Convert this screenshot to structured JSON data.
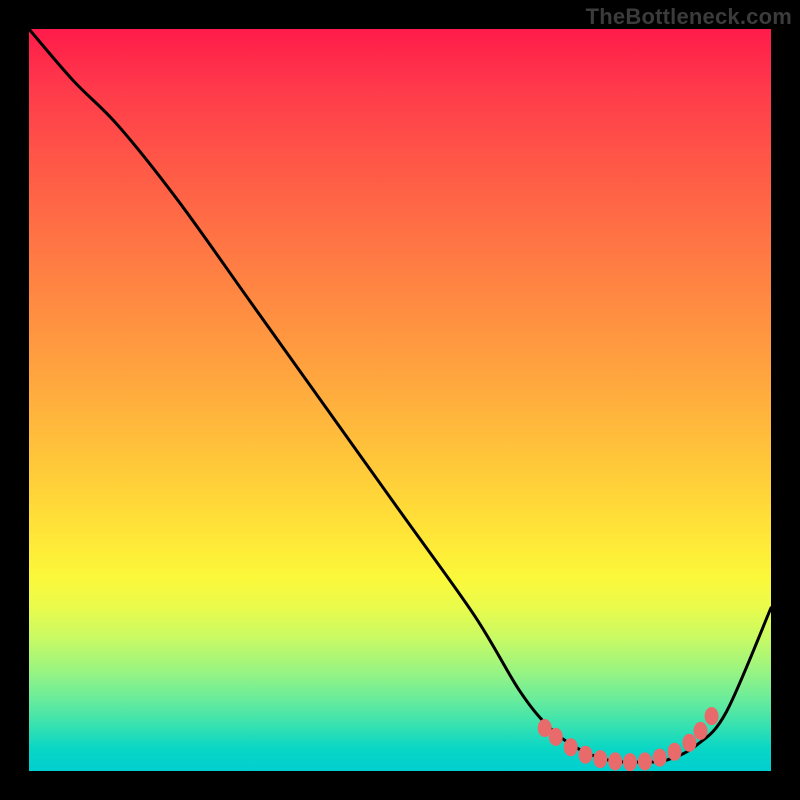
{
  "watermark": "TheBottleneck.com",
  "chart_data": {
    "type": "line",
    "title": "",
    "xlabel": "",
    "ylabel": "",
    "xlim": [
      0,
      100
    ],
    "ylim": [
      0,
      100
    ],
    "series": [
      {
        "name": "bottleneck-curve",
        "x": [
          0,
          6,
          12,
          20,
          30,
          40,
          50,
          60,
          66,
          70,
          74,
          78,
          82,
          86,
          90,
          94,
          100
        ],
        "y": [
          100,
          93,
          87,
          77,
          63,
          49,
          35,
          21,
          11,
          6,
          3,
          1.5,
          1.2,
          1.5,
          3.5,
          8,
          22
        ]
      }
    ],
    "markers": {
      "name": "optimal-zone-dots",
      "color": "#e96a6a",
      "points": [
        {
          "x": 69.5,
          "y": 5.8
        },
        {
          "x": 71.0,
          "y": 4.6
        },
        {
          "x": 73.0,
          "y": 3.2
        },
        {
          "x": 75.0,
          "y": 2.2
        },
        {
          "x": 77.0,
          "y": 1.6
        },
        {
          "x": 79.0,
          "y": 1.3
        },
        {
          "x": 81.0,
          "y": 1.2
        },
        {
          "x": 83.0,
          "y": 1.3
        },
        {
          "x": 85.0,
          "y": 1.8
        },
        {
          "x": 87.0,
          "y": 2.6
        },
        {
          "x": 89.0,
          "y": 3.8
        },
        {
          "x": 90.5,
          "y": 5.4
        },
        {
          "x": 92.0,
          "y": 7.4
        }
      ]
    },
    "gradient_stops": [
      {
        "pct": 0,
        "color": "#ff1b4a"
      },
      {
        "pct": 8,
        "color": "#ff3a4b"
      },
      {
        "pct": 18,
        "color": "#ff5747"
      },
      {
        "pct": 30,
        "color": "#ff7844"
      },
      {
        "pct": 45,
        "color": "#ffa03f"
      },
      {
        "pct": 58,
        "color": "#ffc63a"
      },
      {
        "pct": 68,
        "color": "#ffe537"
      },
      {
        "pct": 74,
        "color": "#fbf83a"
      },
      {
        "pct": 78,
        "color": "#e9fb4c"
      },
      {
        "pct": 82,
        "color": "#c9fa63"
      },
      {
        "pct": 86,
        "color": "#9ff57e"
      },
      {
        "pct": 90,
        "color": "#6eed99"
      },
      {
        "pct": 94,
        "color": "#35e1b1"
      },
      {
        "pct": 97,
        "color": "#09d6c5"
      },
      {
        "pct": 100,
        "color": "#00cfd0"
      }
    ]
  }
}
